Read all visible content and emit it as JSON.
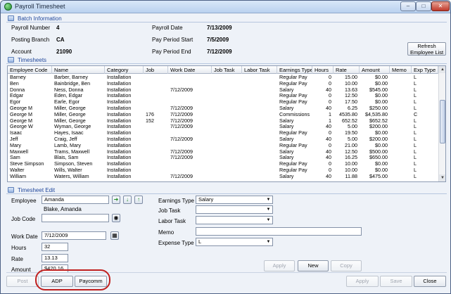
{
  "window": {
    "title": "Payroll Timesheet",
    "min_label": "‒",
    "max_label": "□",
    "close_label": "✕"
  },
  "batch": {
    "header": "Batch Information",
    "payroll_number_label": "Payroll Number",
    "payroll_number": "4",
    "posting_branch_label": "Posting Branch",
    "posting_branch": "CA",
    "account_label": "Account",
    "account": "21090",
    "payroll_date_label": "Payroll Date",
    "payroll_date": "7/13/2009",
    "pay_period_start_label": "Pay Period Start",
    "pay_period_start": "7/5/2009",
    "pay_period_end_label": "Pay Period End",
    "pay_period_end": "7/12/2009",
    "refresh_label_1": "Refresh",
    "refresh_label_2": "Employee List"
  },
  "timesheets": {
    "header": "Timesheets",
    "columns": [
      "Employee Code",
      "Name",
      "Category",
      "Job",
      "Work Date",
      "Job Task",
      "Labor Task",
      "Earnings Type",
      "Hours",
      "Rate",
      "Amount",
      "Memo",
      "Exp Type"
    ],
    "rows": [
      [
        "Barney",
        "Barber, Barney",
        "Installation",
        "",
        "",
        "",
        "",
        "Regular Pay",
        "0",
        "15.00",
        "$0.00",
        "",
        "L"
      ],
      [
        "Ben",
        "Bainbridge, Ben",
        "Installation",
        "",
        "",
        "",
        "",
        "Regular Pay",
        "0",
        "10.00",
        "$0.00",
        "",
        "L"
      ],
      [
        "Donna",
        "Ness, Donna",
        "Installation",
        "",
        "7/12/2009",
        "",
        "",
        "Salary",
        "40",
        "13.63",
        "$545.00",
        "",
        "L"
      ],
      [
        "Edgar",
        "Eden, Edgar",
        "Installation",
        "",
        "",
        "",
        "",
        "Regular Pay",
        "0",
        "12.50",
        "$0.00",
        "",
        "L"
      ],
      [
        "Egor",
        "Earle, Egor",
        "Installation",
        "",
        "",
        "",
        "",
        "Regular Pay",
        "0",
        "17.50",
        "$0.00",
        "",
        "L"
      ],
      [
        "George M",
        "Miller, George",
        "Installation",
        "",
        "7/12/2009",
        "",
        "",
        "Salary",
        "40",
        "6.25",
        "$250.00",
        "",
        "L"
      ],
      [
        "George M",
        "Miller, George",
        "Installation",
        "176",
        "7/12/2009",
        "",
        "",
        "Commissions",
        "1",
        "4535.80",
        "$4,535.80",
        "",
        "C"
      ],
      [
        "George M",
        "Miller, George",
        "Installation",
        "152",
        "7/12/2009",
        "",
        "",
        "Salary",
        "1",
        "652.52",
        "$652.52",
        "",
        "L"
      ],
      [
        "George W",
        "Wyman, George",
        "Installation",
        "",
        "7/12/2009",
        "",
        "",
        "Salary",
        "40",
        "5.00",
        "$200.00",
        "",
        "L"
      ],
      [
        "Isaac",
        "Hayes, Isaac",
        "Installation",
        "",
        "",
        "",
        "",
        "Regular Pay",
        "0",
        "19.50",
        "$0.00",
        "",
        "L"
      ],
      [
        "Jeff",
        "Craig, Jeff",
        "Installation",
        "",
        "7/12/2009",
        "",
        "",
        "Salary",
        "40",
        "5.00",
        "$200.00",
        "",
        "L"
      ],
      [
        "Mary",
        "Lamb, Mary",
        "Installation",
        "",
        "",
        "",
        "",
        "Regular Pay",
        "0",
        "21.00",
        "$0.00",
        "",
        "L"
      ],
      [
        "Maxwell",
        "Trams, Maxwell",
        "Installation",
        "",
        "7/12/2009",
        "",
        "",
        "Salary",
        "40",
        "12.50",
        "$500.00",
        "",
        "L"
      ],
      [
        "Sam",
        "Blais, Sam",
        "Installation",
        "",
        "7/12/2009",
        "",
        "",
        "Salary",
        "40",
        "16.25",
        "$650.00",
        "",
        "L"
      ],
      [
        "Steve Simpson",
        "Simpson, Steven",
        "Installation",
        "",
        "",
        "",
        "",
        "Regular Pay",
        "0",
        "10.00",
        "$0.00",
        "",
        "L"
      ],
      [
        "Walter",
        "Wills, Walter",
        "Installation",
        "",
        "",
        "",
        "",
        "Regular Pay",
        "0",
        "10.00",
        "$0.00",
        "",
        "L"
      ],
      [
        "William",
        "Waters, William",
        "Installation",
        "",
        "7/12/2009",
        "",
        "",
        "Salary",
        "40",
        "11.88",
        "$475.00",
        "",
        "L"
      ]
    ]
  },
  "edit": {
    "header": "Timesheet Edit",
    "employee_label": "Employee",
    "employee_value": "Amanda",
    "employee_name": "Blake, Amanda",
    "job_code_label": "Job Code",
    "job_code_value": "",
    "work_date_label": "Work Date",
    "work_date_value": "7/12/2009",
    "hours_label": "Hours",
    "hours_value": "32",
    "rate_label": "Rate",
    "rate_value": "13.13",
    "amount_label": "Amount",
    "amount_value": "$420.16",
    "earnings_type_label": "Earnings Type",
    "earnings_type_value": "Salary",
    "job_task_label": "Job Task",
    "job_task_value": "",
    "labor_task_label": "Labor Task",
    "labor_task_value": "",
    "memo_label": "Memo",
    "memo_value": "",
    "expense_type_label": "Expense Type",
    "expense_type_value": "L",
    "apply_label": "Apply",
    "new_label": "New",
    "copy_label": "Copy"
  },
  "footer": {
    "post_label": "Post",
    "adp_label": "ADP",
    "paycomm_label": "Paycomm",
    "apply_label": "Apply",
    "save_label": "Save",
    "close_label": "Close"
  },
  "colors": {
    "highlight": "#c0201f",
    "section_header": "#21489c"
  }
}
